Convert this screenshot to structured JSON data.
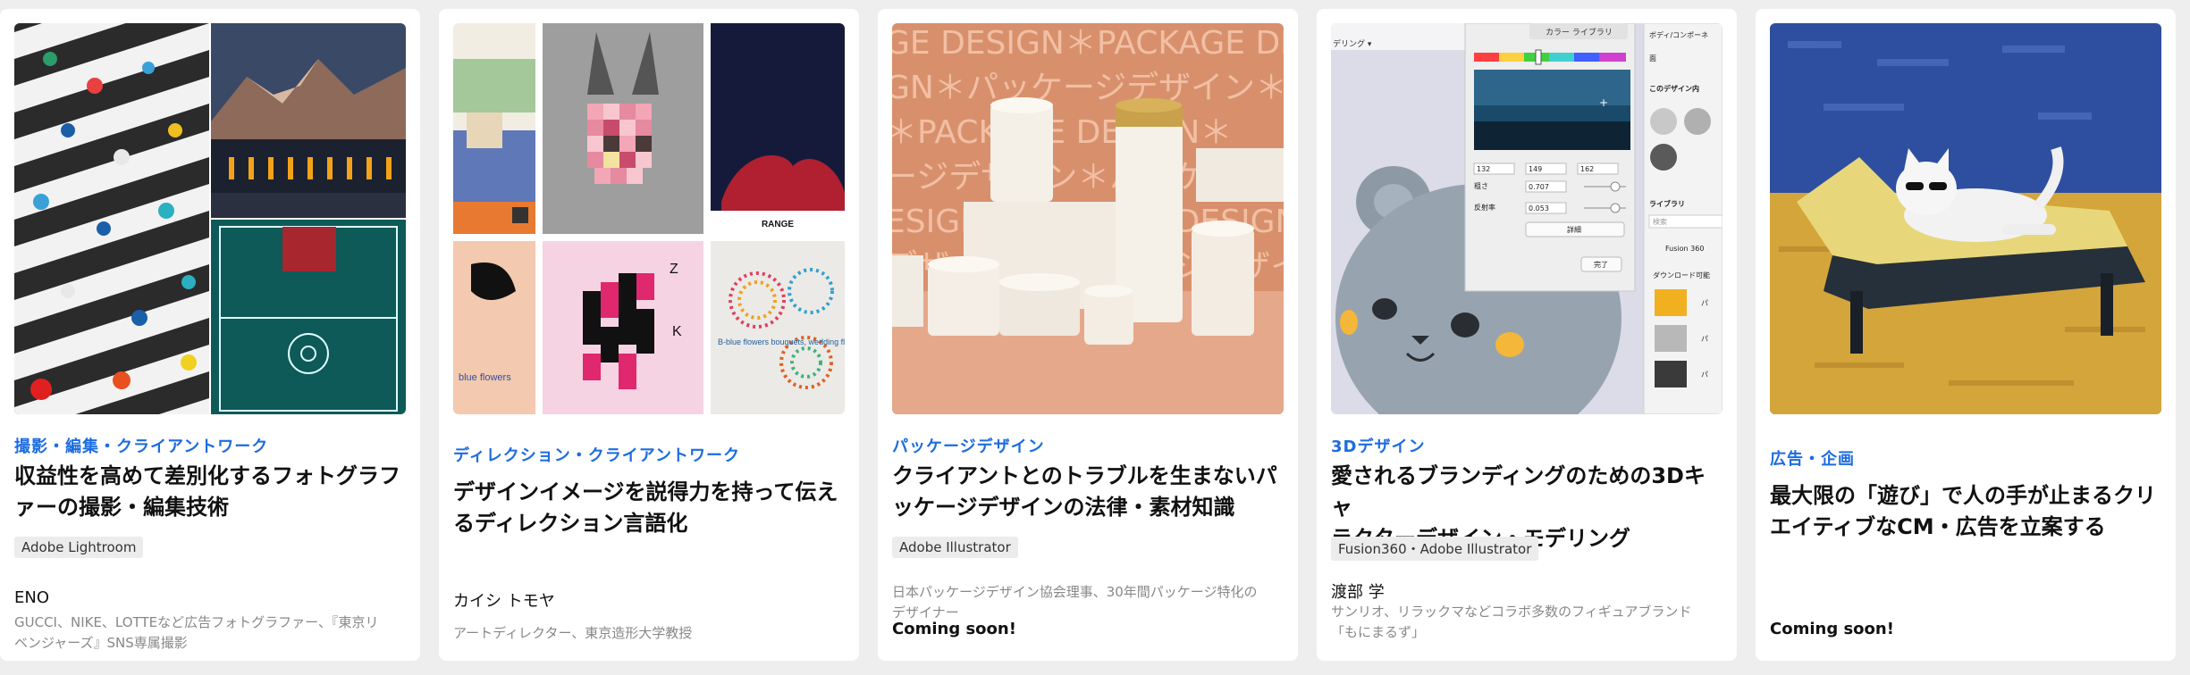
{
  "cards": [
    {
      "category": "撮影・編集・クライアントワーク",
      "title_line1": "収益性を高めて差別化するフォトグラフ",
      "title_line2": "ァーの撮影・編集技術",
      "tag": "Adobe Lightroom",
      "author": "ENO",
      "desc_line1": "GUCCI、NIKE、LOTTEなど広告フォトグラファー、『東京リ",
      "desc_line2": "ベンジャーズ』SNS専属撮影"
    },
    {
      "category": "ディレクション・クライアントワーク",
      "title_line1": "デザインイメージを説得力を持って伝え",
      "title_line2": "るディレクション言語化",
      "author": "カイシ トモヤ",
      "desc_line1": "アートディレクター、東京造形大学教授",
      "thumb_labels": {
        "range": "RANGE",
        "flowers": "blue flowers",
        "z": "Z",
        "k": "K",
        "bouquet": "B-blue flowers bouquets, wedding flowers, arrangements, individual flowers and everything else"
      }
    },
    {
      "category": "パッケージデザイン",
      "title_line1": "クライアントとのトラブルを生まないパ",
      "title_line2": "ッケージデザインの法律・素材知識",
      "tag": "Adobe Illustrator",
      "desc_line1": "日本パッケージデザイン協会理事、30年間パッケージ特化の",
      "desc_line2": "デザイナー",
      "coming_soon": "Coming soon!",
      "thumb_text": [
        "GE DESIGN＊PACKAGE DESIGN",
        "GN＊パッケージデザイン＊",
        "＊PACKAGE DESIGN＊",
        "ージデザイン＊パッケージ",
        "ESIGN＊PACKAGE DESIGN",
        "デザイン＊パッケージデザイン"
      ]
    },
    {
      "category": "3Dデザイン",
      "title_line1": "愛されるブランディングのための3Dキャ",
      "title_line2": "ラクターデザイン・モデリング",
      "tag": "Fusion360・Adobe Illustrator",
      "author": "渡部 学",
      "desc_line1": "サンリオ、リラックマなどコラボ多数のフィギュアブランド",
      "desc_line2": "「もにまるず」",
      "ui": {
        "color_library": "カラー ライブラリ",
        "body_component": "ボディ/コンポーネ",
        "face": "面",
        "in_design": "このデザイン内",
        "library": "ライブラリ",
        "search": "検索",
        "fusion": "Fusion 360",
        "downloadable": "ダウンロード可能",
        "rendering": "デリング ▾",
        "rgb": [
          "132",
          "149",
          "162"
        ],
        "roughness_label": "粗さ",
        "roughness": "0.707",
        "reflect_label": "反射率",
        "reflect": "0.053",
        "detail": "詳細",
        "done": "完了",
        "mat_labels": [
          "パ",
          "パ",
          "パ"
        ]
      }
    },
    {
      "category": "広告・企画",
      "title_line1": "最大限の「遊び」で人の手が止まるクリ",
      "title_line2": "エイティブなCM・広告を立案する",
      "coming_soon": "Coming soon!"
    }
  ],
  "colors": {
    "category_blue": "#1d6ce0",
    "page_bg": "#eeeeee"
  }
}
